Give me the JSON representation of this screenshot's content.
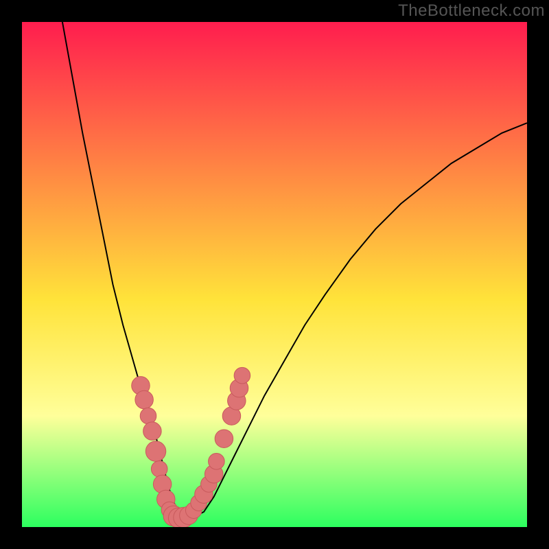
{
  "attribution": "TheBottleneck.com",
  "colors": {
    "frame": "#000000",
    "grad_top": "#ff1d4e",
    "grad_mid": "#ffe33a",
    "grad_low": "#ffff9a",
    "grad_bottom": "#2cff5f",
    "curve": "#000000",
    "dot_fill": "#dd7374",
    "dot_stroke": "#c85a5c"
  },
  "chart_data": {
    "type": "line",
    "title": "",
    "xlabel": "",
    "ylabel": "",
    "xlim": [
      0,
      100
    ],
    "ylim": [
      0,
      100
    ],
    "series": [
      {
        "name": "bottleneck-curve",
        "x": [
          8,
          10,
          12,
          14,
          16,
          18,
          20,
          22,
          24,
          26,
          27,
          28,
          29,
          30,
          31,
          32,
          34,
          36,
          38,
          40,
          42,
          45,
          48,
          52,
          56,
          60,
          65,
          70,
          75,
          80,
          85,
          90,
          95,
          100
        ],
        "values": [
          100,
          89,
          78,
          68,
          58,
          48,
          40,
          33,
          26,
          20,
          16,
          12,
          8,
          5,
          3,
          2,
          2,
          3,
          6,
          10,
          14,
          20,
          26,
          33,
          40,
          46,
          53,
          59,
          64,
          68,
          72,
          75,
          78,
          80
        ]
      }
    ],
    "dots": [
      {
        "x": 23.5,
        "y": 28.0,
        "r": 1.8
      },
      {
        "x": 24.2,
        "y": 25.2,
        "r": 1.8
      },
      {
        "x": 25.0,
        "y": 22.0,
        "r": 1.6
      },
      {
        "x": 25.8,
        "y": 19.0,
        "r": 1.8
      },
      {
        "x": 26.5,
        "y": 15.0,
        "r": 2.0
      },
      {
        "x": 27.2,
        "y": 11.5,
        "r": 1.6
      },
      {
        "x": 27.8,
        "y": 8.5,
        "r": 1.8
      },
      {
        "x": 28.5,
        "y": 5.5,
        "r": 1.8
      },
      {
        "x": 29.2,
        "y": 3.4,
        "r": 1.6
      },
      {
        "x": 30.0,
        "y": 2.2,
        "r": 2.0
      },
      {
        "x": 31.0,
        "y": 1.8,
        "r": 2.0
      },
      {
        "x": 32.0,
        "y": 1.9,
        "r": 2.0
      },
      {
        "x": 33.0,
        "y": 2.3,
        "r": 1.8
      },
      {
        "x": 34.0,
        "y": 3.3,
        "r": 1.6
      },
      {
        "x": 35.0,
        "y": 4.8,
        "r": 1.6
      },
      {
        "x": 36.0,
        "y": 6.5,
        "r": 1.8
      },
      {
        "x": 37.0,
        "y": 8.5,
        "r": 1.6
      },
      {
        "x": 38.0,
        "y": 10.5,
        "r": 1.8
      },
      {
        "x": 38.5,
        "y": 13.0,
        "r": 1.6
      },
      {
        "x": 40.0,
        "y": 17.5,
        "r": 1.8
      },
      {
        "x": 41.5,
        "y": 22.0,
        "r": 1.8
      },
      {
        "x": 42.5,
        "y": 25.0,
        "r": 1.8
      },
      {
        "x": 43.0,
        "y": 27.5,
        "r": 1.8
      },
      {
        "x": 43.6,
        "y": 30.0,
        "r": 1.6
      }
    ]
  }
}
